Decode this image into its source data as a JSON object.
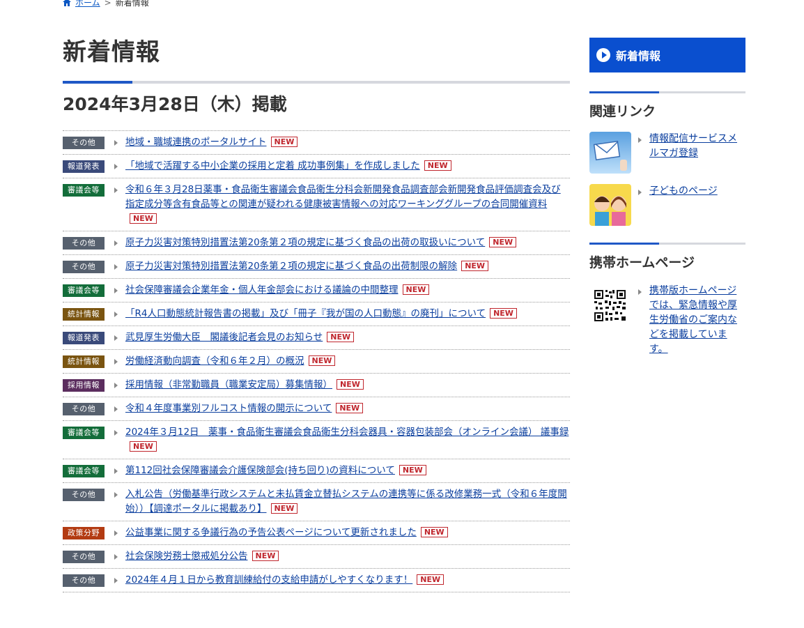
{
  "breadcrumb": {
    "home": "ホーム",
    "separator": ">",
    "current": "新着情報"
  },
  "page_title": "新着情報",
  "date_heading": "2024年3月28日（木）掲載",
  "new_label": "NEW",
  "categories": {
    "other": {
      "label": "その他",
      "color": "#56606e"
    },
    "press": {
      "label": "報道発表",
      "color": "#3a4a7a"
    },
    "council": {
      "label": "審議会等",
      "color": "#136d3a"
    },
    "stats": {
      "label": "統計情報",
      "color": "#7a5410"
    },
    "recruit": {
      "label": "採用情報",
      "color": "#5b2d5e"
    },
    "policy": {
      "label": "政策分野",
      "color": "#b33b12"
    }
  },
  "news": [
    {
      "category": "その他",
      "color": "#56606e",
      "text": "地域・職域連携のポータルサイト"
    },
    {
      "category": "報道発表",
      "color": "#3a4a7a",
      "text": "「地域で活躍する中小企業の採用と定着 成功事例集」を作成しました"
    },
    {
      "category": "審議会等",
      "color": "#136d3a",
      "text": "令和６年３月28日薬事・食品衛生審議会食品衛生分科会新開発食品調査部会新開発食品評価調査会及び指定成分等含有食品等との関連が疑われる健康被害情報への対応ワーキンググループの合同開催資料"
    },
    {
      "category": "その他",
      "color": "#56606e",
      "text": "原子力災害対策特別措置法第20条第２項の規定に基づく食品の出荷の取扱いについて"
    },
    {
      "category": "その他",
      "color": "#56606e",
      "text": "原子力災害対策特別措置法第20条第２項の規定に基づく食品の出荷制限の解除"
    },
    {
      "category": "審議会等",
      "color": "#136d3a",
      "text": "社会保障審議会企業年金・個人年金部会における議論の中間整理"
    },
    {
      "category": "統計情報",
      "color": "#7a5410",
      "text": "「R4人口動態統計報告書の掲載」及び「冊子『我が国の人口動態』の廃刊」について"
    },
    {
      "category": "報道発表",
      "color": "#3a4a7a",
      "text": "武見厚生労働大臣　閣議後記者会見のお知らせ"
    },
    {
      "category": "統計情報",
      "color": "#7a5410",
      "text": "労働経済動向調査（令和６年２月）の概況"
    },
    {
      "category": "採用情報",
      "color": "#5b2d5e",
      "text": "採用情報（非常勤職員（職業安定局）募集情報）"
    },
    {
      "category": "その他",
      "color": "#56606e",
      "text": "令和４年度事業別フルコスト情報の開示について"
    },
    {
      "category": "審議会等",
      "color": "#136d3a",
      "text": "2024年３月12日　薬事・食品衛生審議会食品衛生分科会器具・容器包装部会（オンライン会議） 議事録"
    },
    {
      "category": "審議会等",
      "color": "#136d3a",
      "text": "第112回社会保障審議会介護保険部会(持ち回り)の資料について"
    },
    {
      "category": "その他",
      "color": "#56606e",
      "text": "入札公告（労働基準行政システムと未払賃金立替払システムの連携等に係る改修業務一式（令和６年度開始））【調達ポータルに掲載あり】"
    },
    {
      "category": "政策分野",
      "color": "#b33b12",
      "text": "公益事業に関する争議行為の予告公表ページについて更新されました"
    },
    {
      "category": "その他",
      "color": "#56606e",
      "text": "社会保険労務士懲戒処分公告"
    },
    {
      "category": "その他",
      "color": "#56606e",
      "text": "2024年４月１日から教育訓練給付の支給申請がしやすくなります！"
    }
  ],
  "sidebar": {
    "nav_label": "新着情報",
    "related_heading": "関連リンク",
    "related_links": [
      {
        "text": "情報配信サービスメルマガ登録",
        "icon": "mail-envelope-icon"
      },
      {
        "text": "子どものページ",
        "icon": "children-icon"
      }
    ],
    "mobile_heading": "携帯ホームページ",
    "mobile_text": "携帯版ホームページでは、緊急情報や厚生労働省のご案内などを掲載しています。"
  }
}
